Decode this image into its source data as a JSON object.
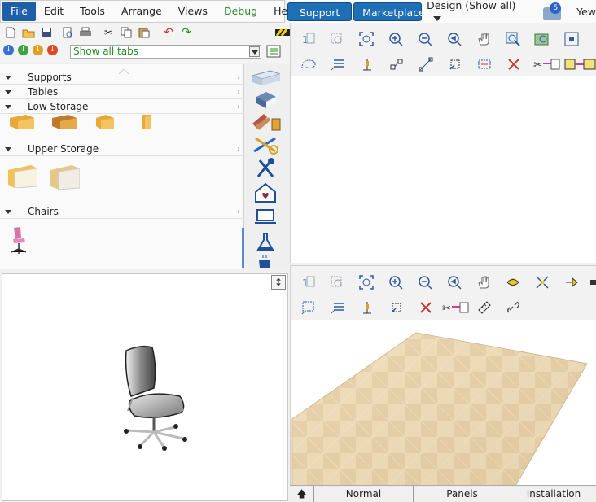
{
  "menubar": {
    "items": [
      "File",
      "Edit",
      "Tools",
      "Arrange",
      "Views",
      "Debug",
      "Help"
    ]
  },
  "topbar": {
    "support_label": "Support",
    "marketplace_label": "Marketplace",
    "design_select": "Design (Show all)",
    "notification_count": "5",
    "user_label": "Yew"
  },
  "left_toolbar": {
    "tab_filter_value": "Show all tabs"
  },
  "catalog": {
    "sections": [
      {
        "label": "Supports"
      },
      {
        "label": "Tables"
      },
      {
        "label": "Low Storage"
      },
      {
        "label": "Upper Storage"
      },
      {
        "label": "Chairs"
      }
    ]
  },
  "bottom_tabs": {
    "items": [
      "Normal",
      "Panels",
      "Installation"
    ]
  },
  "icons": {
    "expand": "expand-vertical-icon",
    "up": "up-arrow-icon"
  },
  "colors": {
    "accent": "#1e6fb5",
    "file_menu": "#1e5fa8",
    "debug_text": "#2a8a2a"
  }
}
